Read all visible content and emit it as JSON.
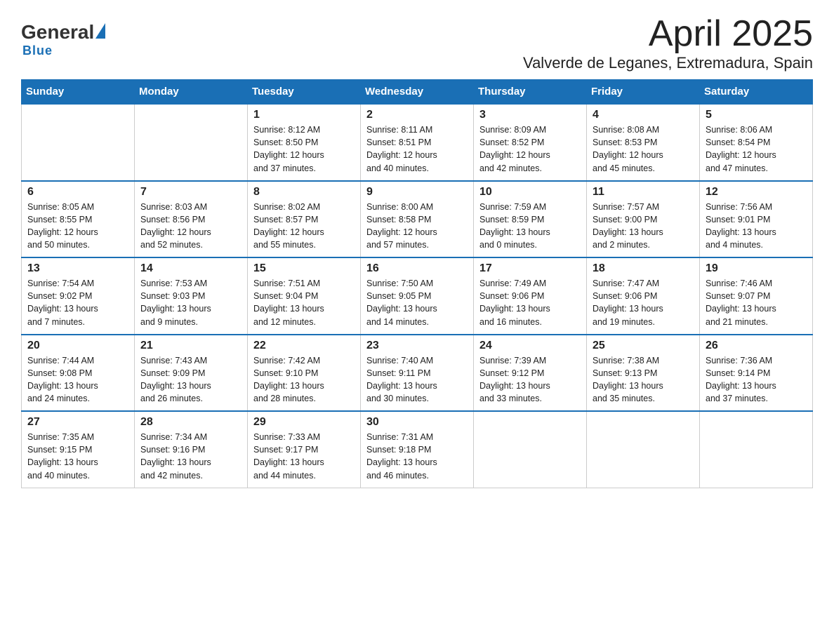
{
  "logo": {
    "general": "General",
    "blue": "Blue"
  },
  "title": "April 2025",
  "subtitle": "Valverde de Leganes, Extremadura, Spain",
  "weekdays": [
    "Sunday",
    "Monday",
    "Tuesday",
    "Wednesday",
    "Thursday",
    "Friday",
    "Saturday"
  ],
  "weeks": [
    [
      {
        "day": "",
        "info": ""
      },
      {
        "day": "",
        "info": ""
      },
      {
        "day": "1",
        "info": "Sunrise: 8:12 AM\nSunset: 8:50 PM\nDaylight: 12 hours\nand 37 minutes."
      },
      {
        "day": "2",
        "info": "Sunrise: 8:11 AM\nSunset: 8:51 PM\nDaylight: 12 hours\nand 40 minutes."
      },
      {
        "day": "3",
        "info": "Sunrise: 8:09 AM\nSunset: 8:52 PM\nDaylight: 12 hours\nand 42 minutes."
      },
      {
        "day": "4",
        "info": "Sunrise: 8:08 AM\nSunset: 8:53 PM\nDaylight: 12 hours\nand 45 minutes."
      },
      {
        "day": "5",
        "info": "Sunrise: 8:06 AM\nSunset: 8:54 PM\nDaylight: 12 hours\nand 47 minutes."
      }
    ],
    [
      {
        "day": "6",
        "info": "Sunrise: 8:05 AM\nSunset: 8:55 PM\nDaylight: 12 hours\nand 50 minutes."
      },
      {
        "day": "7",
        "info": "Sunrise: 8:03 AM\nSunset: 8:56 PM\nDaylight: 12 hours\nand 52 minutes."
      },
      {
        "day": "8",
        "info": "Sunrise: 8:02 AM\nSunset: 8:57 PM\nDaylight: 12 hours\nand 55 minutes."
      },
      {
        "day": "9",
        "info": "Sunrise: 8:00 AM\nSunset: 8:58 PM\nDaylight: 12 hours\nand 57 minutes."
      },
      {
        "day": "10",
        "info": "Sunrise: 7:59 AM\nSunset: 8:59 PM\nDaylight: 13 hours\nand 0 minutes."
      },
      {
        "day": "11",
        "info": "Sunrise: 7:57 AM\nSunset: 9:00 PM\nDaylight: 13 hours\nand 2 minutes."
      },
      {
        "day": "12",
        "info": "Sunrise: 7:56 AM\nSunset: 9:01 PM\nDaylight: 13 hours\nand 4 minutes."
      }
    ],
    [
      {
        "day": "13",
        "info": "Sunrise: 7:54 AM\nSunset: 9:02 PM\nDaylight: 13 hours\nand 7 minutes."
      },
      {
        "day": "14",
        "info": "Sunrise: 7:53 AM\nSunset: 9:03 PM\nDaylight: 13 hours\nand 9 minutes."
      },
      {
        "day": "15",
        "info": "Sunrise: 7:51 AM\nSunset: 9:04 PM\nDaylight: 13 hours\nand 12 minutes."
      },
      {
        "day": "16",
        "info": "Sunrise: 7:50 AM\nSunset: 9:05 PM\nDaylight: 13 hours\nand 14 minutes."
      },
      {
        "day": "17",
        "info": "Sunrise: 7:49 AM\nSunset: 9:06 PM\nDaylight: 13 hours\nand 16 minutes."
      },
      {
        "day": "18",
        "info": "Sunrise: 7:47 AM\nSunset: 9:06 PM\nDaylight: 13 hours\nand 19 minutes."
      },
      {
        "day": "19",
        "info": "Sunrise: 7:46 AM\nSunset: 9:07 PM\nDaylight: 13 hours\nand 21 minutes."
      }
    ],
    [
      {
        "day": "20",
        "info": "Sunrise: 7:44 AM\nSunset: 9:08 PM\nDaylight: 13 hours\nand 24 minutes."
      },
      {
        "day": "21",
        "info": "Sunrise: 7:43 AM\nSunset: 9:09 PM\nDaylight: 13 hours\nand 26 minutes."
      },
      {
        "day": "22",
        "info": "Sunrise: 7:42 AM\nSunset: 9:10 PM\nDaylight: 13 hours\nand 28 minutes."
      },
      {
        "day": "23",
        "info": "Sunrise: 7:40 AM\nSunset: 9:11 PM\nDaylight: 13 hours\nand 30 minutes."
      },
      {
        "day": "24",
        "info": "Sunrise: 7:39 AM\nSunset: 9:12 PM\nDaylight: 13 hours\nand 33 minutes."
      },
      {
        "day": "25",
        "info": "Sunrise: 7:38 AM\nSunset: 9:13 PM\nDaylight: 13 hours\nand 35 minutes."
      },
      {
        "day": "26",
        "info": "Sunrise: 7:36 AM\nSunset: 9:14 PM\nDaylight: 13 hours\nand 37 minutes."
      }
    ],
    [
      {
        "day": "27",
        "info": "Sunrise: 7:35 AM\nSunset: 9:15 PM\nDaylight: 13 hours\nand 40 minutes."
      },
      {
        "day": "28",
        "info": "Sunrise: 7:34 AM\nSunset: 9:16 PM\nDaylight: 13 hours\nand 42 minutes."
      },
      {
        "day": "29",
        "info": "Sunrise: 7:33 AM\nSunset: 9:17 PM\nDaylight: 13 hours\nand 44 minutes."
      },
      {
        "day": "30",
        "info": "Sunrise: 7:31 AM\nSunset: 9:18 PM\nDaylight: 13 hours\nand 46 minutes."
      },
      {
        "day": "",
        "info": ""
      },
      {
        "day": "",
        "info": ""
      },
      {
        "day": "",
        "info": ""
      }
    ]
  ]
}
